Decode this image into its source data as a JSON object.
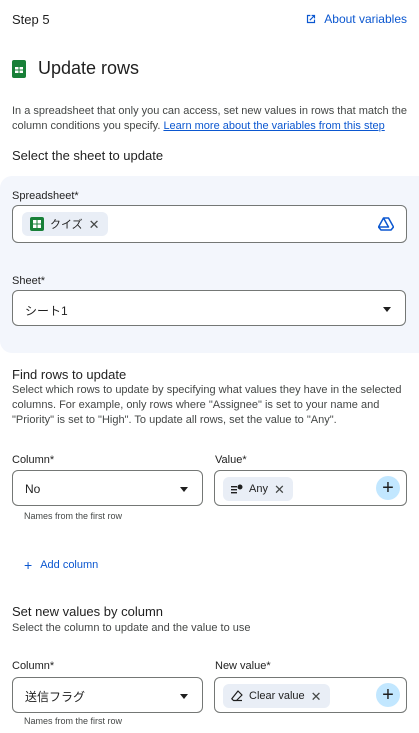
{
  "header": {
    "step_label": "Step 5",
    "about_link": "About variables"
  },
  "action": {
    "title": "Update rows",
    "description": "In a spreadsheet that only you can access, set new values in rows that match the column conditions you specify.",
    "learn_more_link": "Learn more about the variables from this step"
  },
  "select_sheet": {
    "section_title": "Select the sheet to update",
    "spreadsheet_label": "Spreadsheet*",
    "spreadsheet_value": "クイズ",
    "sheet_label": "Sheet*",
    "sheet_value": "シート1"
  },
  "find_rows": {
    "section_title": "Find rows to update",
    "section_desc": "Select which rows to update by specifying what values they have in the selected columns. For example, only rows where \"Assignee\" is set to your name and \"Priority\" is set to \"High\". To update all rows, set the value to \"Any\".",
    "column_label": "Column*",
    "column_value": "No",
    "value_label": "Value*",
    "value_chip": "Any",
    "column_helper": "Names from the first row",
    "add_column": "Add column"
  },
  "set_values": {
    "section_title": "Set new values by column",
    "section_desc": "Select the column to update and the value to use",
    "column_label": "Column*",
    "column_value": "送信フラグ",
    "new_value_label": "New value*",
    "new_value_chip": "Clear value",
    "column_helper": "Names from the first row"
  },
  "colors": {
    "accent": "#0b57d0",
    "sheets_green": "#188038",
    "panel_bg": "#f3f6fc",
    "chip_bg": "#e9eef6",
    "plus_bg": "#c2e7ff"
  },
  "icons": {
    "about": "open-in-new-icon",
    "sheets": "google-sheets-icon",
    "drive": "google-drive-icon",
    "any_chip": "variable-icon",
    "clear_chip": "eraser-icon",
    "add": "plus-icon"
  }
}
